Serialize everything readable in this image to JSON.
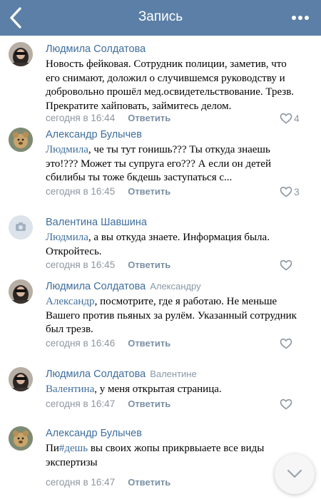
{
  "header": {
    "title": "Запись",
    "back_icon": "chevron-left-icon",
    "menu_icon": "more-dots-icon",
    "bg_color": "#5b7fa6"
  },
  "comments": [
    {
      "author": "Людмила Солдатова",
      "reply_to": "",
      "mention": "",
      "text": "Новость фейковая. Сотрудник полиции, заметив, что его снимают, доложил о случившемся руководству и добровольно прошёл мед.освидетельствование. Трезв. Прекратите хайповать, займитесь делом.",
      "time": "сегодня в 16:44",
      "reply_label": "Ответить",
      "likes": "4"
    },
    {
      "author": "Александр Булычев",
      "reply_to": "",
      "mention": "Людмила",
      "text": ", че ты тут гонишь??? Ты откуда знаешь это!??? Может ты супруга его??? А если он детей сбилибы ты тоже бкдешь заступаться с...",
      "time": "сегодня в 16:45",
      "reply_label": "Ответить",
      "likes": "3"
    },
    {
      "author": "Валентина Шавшина",
      "reply_to": "",
      "mention": "Людмила",
      "text": ", а вы откуда знаете. Информация была. Откройтесь.",
      "time": "сегодня в 16:45",
      "reply_label": "Ответить",
      "likes": ""
    },
    {
      "author": "Людмила Солдатова",
      "reply_to": "Александру",
      "mention": "Александр",
      "text": ", посмотрите, где я работаю. Не меньше Вашего против пьяных за рулём. Указанный сотрудник был трезв.",
      "time": "сегодня в 16:46",
      "reply_label": "Ответить",
      "likes": ""
    },
    {
      "author": "Людмила Солдатова",
      "reply_to": "Валентине",
      "mention": "Валентина",
      "text": ", у меня открытая страница.",
      "time": "сегодня в 16:47",
      "reply_label": "Ответить",
      "likes": ""
    },
    {
      "author": "Александр Булычев",
      "reply_to": "",
      "mention": "",
      "text_prefix": "Пи",
      "text_hashtag": "#дешь",
      "text": " вы своих жопы прикрвыаете все виды экспертизы",
      "time": "сегодня в 16:47",
      "reply_label": "Ответить",
      "likes": ""
    }
  ],
  "colors": {
    "link": "#3f6e9c",
    "meta": "#8d96a0"
  },
  "icons": {
    "like": "heart-outline-icon",
    "scroll_down": "chevron-down-icon",
    "camera_placeholder": "camera-icon"
  }
}
